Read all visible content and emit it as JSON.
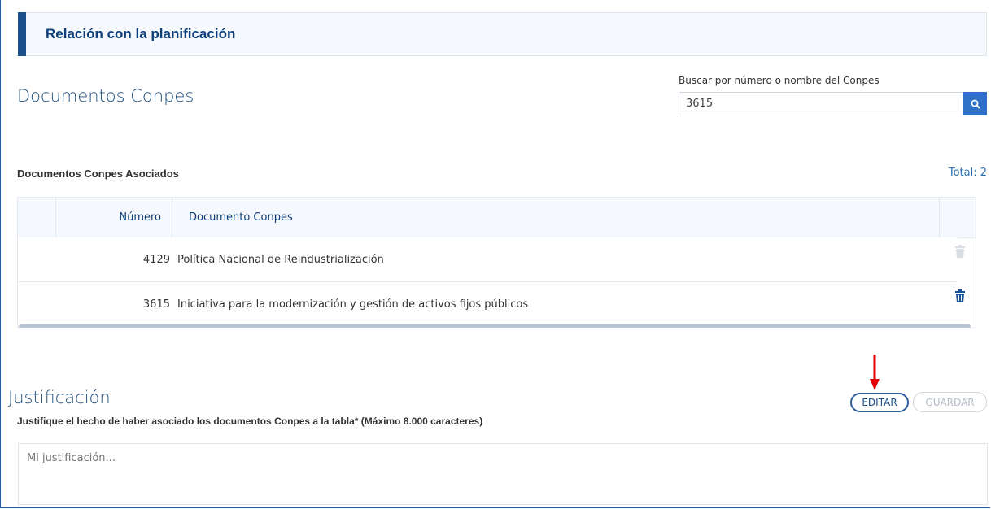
{
  "section": {
    "title": "Relación con la planificación"
  },
  "conpes": {
    "title": "Documentos Conpes",
    "search_label": "Buscar por número o nombre del Conpes",
    "search_value": "3615",
    "search_icon": "search-icon"
  },
  "associated": {
    "title": "Documentos Conpes Asociados",
    "total": "Total: 2",
    "columns": {
      "number": "Número",
      "document": "Documento Conpes"
    },
    "rows": [
      {
        "number": "4129",
        "document": "Política Nacional de Reindustrialización",
        "trash_state": "disabled"
      },
      {
        "number": "3615",
        "document": "Iniciativa para la modernización y gestión de activos fijos públicos",
        "trash_state": "enabled"
      }
    ]
  },
  "justification": {
    "title": "Justificación",
    "label": "Justifique el hecho de haber asociado los documentos Conpes a la tabla* (Máximo 8.000 caracteres)",
    "placeholder": "Mi justificación...",
    "edit_label": "EDITAR",
    "save_label": "GUARDAR"
  },
  "colors": {
    "primary": "#1a4f8a",
    "accent": "#2f70c9",
    "annotation_arrow": "#e10000"
  }
}
